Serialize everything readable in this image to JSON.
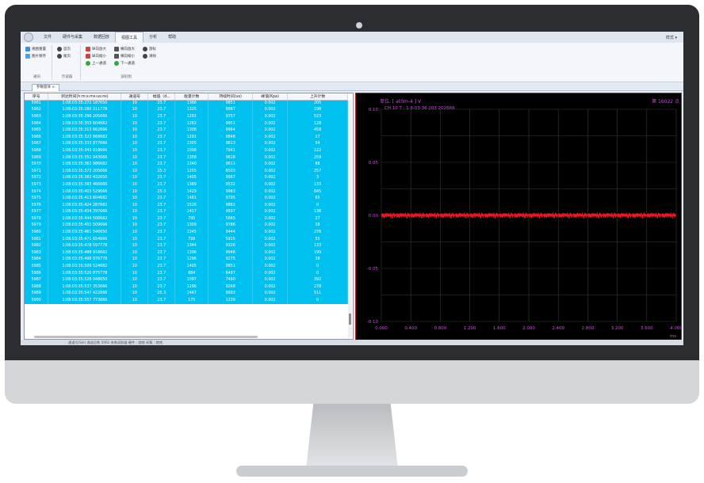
{
  "menu": {
    "items": [
      "文件",
      "硬件与采集",
      "数据回放",
      "视图工具",
      "分析",
      "帮助"
    ],
    "active_index": 3,
    "right_label": "样式 ▾"
  },
  "ribbon": {
    "group1": {
      "label": "通讯",
      "items": [
        "视图重置",
        "图片保存"
      ]
    },
    "group2": {
      "label": "示波器",
      "items": [
        "首页",
        "尾页"
      ]
    },
    "group3": {
      "label": "波形图",
      "items": [
        "纵向放大",
        "纵向缩小",
        "上一通道",
        "横向放大",
        "横向缩小",
        "下一通道",
        "游标",
        "清除"
      ]
    }
  },
  "doc_tab": {
    "label": "参数窗体 ×"
  },
  "table": {
    "headers": [
      "序号",
      "到达时间(h:m:s:ms:us:ns)",
      "通道号",
      "幅值（d...",
      "能量计数",
      "持续时间(us)",
      "峰值(Kpa)",
      "上升计数"
    ],
    "rows": [
      [
        "5961",
        "1:08:03:35:272 187650",
        "10",
        "23.7",
        "1366",
        "9851",
        "0.002",
        "205"
      ],
      [
        "5962",
        "1:08:03:35:280 211778",
        "10",
        "23.7",
        "1325",
        "9987",
        "0.002",
        "198"
      ],
      [
        "5963",
        "1:08:03:35:298 205666",
        "10",
        "23.7",
        "1291",
        "9757",
        "0.002",
        "523"
      ],
      [
        "5964",
        "1:08:03:35:303 604682",
        "10",
        "23.7",
        "1262",
        "9951",
        "0.002",
        "128"
      ],
      [
        "5965",
        "1:08:03:35:313 662666",
        "10",
        "23.7",
        "1308",
        "9964",
        "0.002",
        "458"
      ],
      [
        "5966",
        "1:08:03:35:323 868682",
        "10",
        "23.7",
        "1291",
        "9848",
        "0.002",
        "17"
      ],
      [
        "5967",
        "1:08:03:35:333 877666",
        "10",
        "23.7",
        "1305",
        "9613",
        "0.002",
        "54"
      ],
      [
        "5968",
        "1:08:03:35:343 918666",
        "10",
        "23.7",
        "1098",
        "7941",
        "0.002",
        "122"
      ],
      [
        "5969",
        "1:08:03:35:352 943666",
        "10",
        "23.7",
        "1358",
        "9618",
        "0.002",
        "259"
      ],
      [
        "5970",
        "1:08:03:35:362 986682",
        "10",
        "23.7",
        "1340",
        "9611",
        "0.002",
        "88"
      ],
      [
        "5971",
        "1:08:03:35:373 205666",
        "10",
        "25.3",
        "1255",
        "8503",
        "0.002",
        "257"
      ],
      [
        "5972",
        "1:08:03:35:383 432650",
        "10",
        "23.7",
        "1405",
        "9967",
        "0.002",
        "3"
      ],
      [
        "5973",
        "1:08:03:35:393 466666",
        "10",
        "23.7",
        "1389",
        "9532",
        "0.002",
        "133"
      ],
      [
        "5974",
        "1:08:03:35:403 529666",
        "10",
        "25.3",
        "1429",
        "9983",
        "0.002",
        "845"
      ],
      [
        "5975",
        "1:08:03:35:413 604682",
        "10",
        "23.7",
        "1481",
        "9795",
        "0.002",
        "65"
      ],
      [
        "5976",
        "1:08:03:35:424 287682",
        "10",
        "23.7",
        "1526",
        "9862",
        "0.002",
        "0"
      ],
      [
        "5977",
        "1:08:03:35:434 397666",
        "10",
        "23.7",
        "1417",
        "9937",
        "0.002",
        "136"
      ],
      [
        "5978",
        "1:08:03:35:444 506682",
        "10",
        "23.7",
        "795",
        "5665",
        "0.002",
        "27"
      ],
      [
        "5979",
        "1:08:03:35:451 509666",
        "10",
        "23.7",
        "1309",
        "9786",
        "0.002",
        "38"
      ],
      [
        "5980",
        "1:08:03:35:461 546650",
        "10",
        "23.7",
        "1345",
        "9444",
        "0.002",
        "276"
      ],
      [
        "5981",
        "1:08:03:35:471 654666",
        "10",
        "23.7",
        "798",
        "5915",
        "0.002",
        "55"
      ],
      [
        "5982",
        "1:08:03:35:478 597778",
        "10",
        "23.7",
        "1344",
        "9326",
        "0.002",
        "133"
      ],
      [
        "5983",
        "1:08:03:35:488 916682",
        "10",
        "23.7",
        "1396",
        "9946",
        "0.002",
        "199"
      ],
      [
        "5984",
        "1:08:03:35:498 976778",
        "10",
        "23.7",
        "1296",
        "9275",
        "0.002",
        "38"
      ],
      [
        "5985",
        "1:08:03:35:509 524682",
        "10",
        "23.7",
        "1405",
        "9851",
        "0.002",
        "0"
      ],
      [
        "5986",
        "1:08:03:35:520 875778",
        "10",
        "23.7",
        "884",
        "6497",
        "0.002",
        "0"
      ],
      [
        "5987",
        "1:08:03:35:528 048650",
        "10",
        "23.7",
        "1097",
        "7490",
        "0.002",
        "392"
      ],
      [
        "5988",
        "1:08:03:35:537 353666",
        "10",
        "23.7",
        "1296",
        "9268",
        "0.002",
        "278"
      ],
      [
        "5989",
        "1:08:03:35:547 422666",
        "10",
        "25.3",
        "1467",
        "9993",
        "0.002",
        "511"
      ],
      [
        "5990",
        "1:08:03:35:557 773666",
        "10",
        "23.7",
        "175",
        "1239",
        "0.002",
        "0"
      ]
    ]
  },
  "chart": {
    "header_left": "单位: [ at0m-4 ] V",
    "header_right": "第 16022 点",
    "caption": "CH 10  T : 1 8:03:36 203 202666",
    "x_unit": "ms",
    "colors": {
      "trace": "#e8191e",
      "grid": "#3a3a3a",
      "text": "#d04ce0",
      "border": "#c0201e"
    }
  },
  "chart_data": {
    "type": "line",
    "title": "",
    "xlabel": "ms",
    "ylabel": "",
    "xlim": [
      0.0,
      4.0
    ],
    "ylim": [
      -0.1,
      0.1
    ],
    "xticks": [
      "0.000",
      "0.400",
      "0.800",
      "1.200",
      "1.600",
      "2.000",
      "2.400",
      "2.800",
      "3.200",
      "3.600",
      "4.000"
    ],
    "yticks": [
      "0.10",
      "0.05",
      "0.00",
      "-0.05",
      "-0.10"
    ],
    "series": [
      {
        "name": "CH 10",
        "values": [
          0.0,
          0.001,
          -0.001,
          0.0015,
          -0.0008,
          0.0012,
          -0.0015,
          0.0007,
          -0.001,
          0.0013,
          0.0,
          -0.0012,
          0.001,
          -0.0006,
          0.0009,
          -0.0013,
          0.0011,
          0.0,
          -0.0009,
          0.0014,
          -0.0011,
          0.0006,
          -0.0014,
          0.0008,
          0.001,
          -0.0007,
          0.0012,
          -0.001,
          0.0005,
          0.0
        ]
      }
    ]
  },
  "status": {
    "text": "通道号(Sel)    通道总数 5962    参数读取器    硬件 : 就绪    采集 : 就绪"
  }
}
